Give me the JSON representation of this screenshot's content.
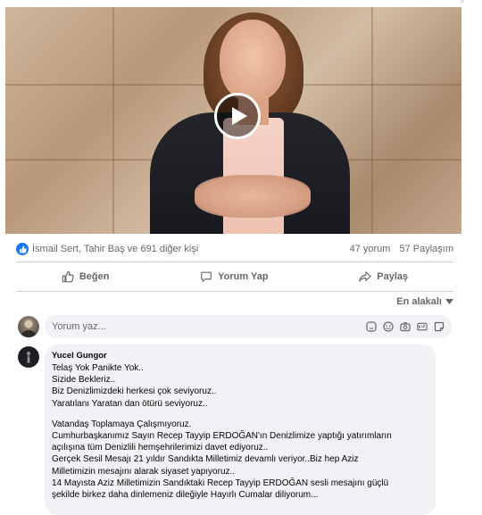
{
  "post": {
    "reactions_text": "İsmail Sert, Tahir Baş ve 691 diğer kişi",
    "comments_count": "47 yorum",
    "shares_count": "57 Paylaşım"
  },
  "actions": {
    "like": "Beğen",
    "comment": "Yorum Yap",
    "share": "Paylaş"
  },
  "sort": {
    "label": "En alakalı"
  },
  "composer": {
    "placeholder": "Yorum yaz..."
  },
  "comment": {
    "author": "Yucel Gungor",
    "paragraph1": [
      "Telaş Yok Panikte Yok..",
      "Sizide Bekleriz..",
      "Biz Denizlimizdeki herkesi çok seviyoruz..",
      "Yaratılanı Yaratan dan ötürü seviyoruz.."
    ],
    "paragraph2": [
      "Vatandaş Toplamaya Çalışmıyoruz.",
      "Cumhurbaşkanımız Sayın Recep Tayyip ERDOĞAN'ın Denizlimize yaptığı yatırımların",
      "açılışına tüm Denizlili hemşehrilerimizi davet ediyoruz..",
      "Gerçek Sesil Mesajı 21 yıldır Sandıkta Milletimiz devamlı veriyor..Biz hep Aziz",
      "Milletimizin mesajını alarak siyaset yapıyoruz..",
      "14 Mayısta Aziz Milletimizin Sandıktaki Recep Tayyip ERDOĞAN sesli mesajını güçlü",
      "şekilde birkez daha dinlemeniz dileğiyle Hayırlı Cumalar diliyorum..."
    ]
  },
  "colors": {
    "accent": "#1877f2",
    "muted_text": "#65676b",
    "bubble": "#f0f2f5"
  },
  "icons": [
    "play-icon",
    "like-badge-icon",
    "thumbs-up-icon",
    "comment-icon",
    "share-icon",
    "chevron-down-icon",
    "sticker-icon",
    "emoji-icon",
    "camera-icon",
    "gif-icon",
    "avatar-sticker-icon"
  ]
}
